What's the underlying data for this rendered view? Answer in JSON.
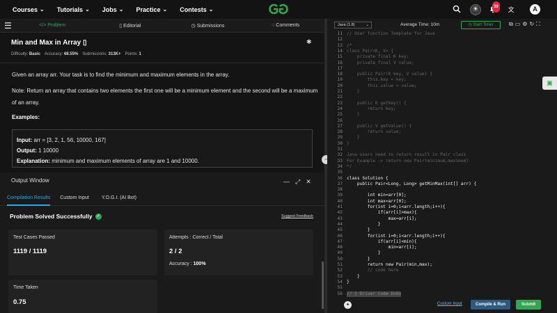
{
  "nav": {
    "items": [
      "Courses",
      "Tutorials",
      "Jobs",
      "Practice",
      "Contests"
    ],
    "notification_count": "39",
    "avatar_initial": "A"
  },
  "tabs": {
    "problem": "Problem",
    "editorial": "Editorial",
    "submissions": "Submissions",
    "comments": "Comments"
  },
  "problem": {
    "title": "Min and Max in Array",
    "difficulty_label": "Difficulty:",
    "difficulty": "Basic",
    "accuracy_label": "Accuracy:",
    "accuracy": "68.55%",
    "submissions_label": "Submissions:",
    "submissions": "313K+",
    "points_label": "Points:",
    "points": "1",
    "desc1": "Given an array arr. Your task is to find the minimum and maximum elements in the array.",
    "desc2": "Note: Return an array that contains two elements the first one will be a minimum element and the second will be a maximum of an array.",
    "examples_heading": "Examples:",
    "input_label": "Input:",
    "input_value": " arr = [3, 2, 1, 56, 10000, 167]",
    "output_label": "Output:",
    "output_value": " 1 10000",
    "explanation_label": "Explanation:",
    "explanation_value": " minimum and maximum elements of array are 1 and 10000."
  },
  "output_window": {
    "title": "Output Window",
    "tabs": [
      "Compilation Results",
      "Custom Input",
      "Y.O.G.I. (AI Bot)"
    ],
    "status": "Problem Solved Successfully",
    "suggest_feedback": "Suggest Feedback",
    "test_cases_label": "Test Cases Passed",
    "test_cases_value": "1119 / 1119",
    "attempts_label": "Attempts : Correct / Total",
    "attempts_value": "2 / 2",
    "accuracy_label": "Accuracy :",
    "accuracy_value": "100%",
    "time_label": "Time Taken",
    "time_value": "0.75"
  },
  "editor": {
    "language": "Java (1.8)",
    "average_time": "Average Time: 10m",
    "start_timer": "Start Timer",
    "lines": [
      {
        "n": "11",
        "t": "// User function Template for Java",
        "c": "cm"
      },
      {
        "n": "12",
        "t": "",
        "c": ""
      },
      {
        "n": "13",
        "t": "/*",
        "c": "cm"
      },
      {
        "n": "14",
        "t": "class Pair<K, V> {",
        "c": "cm"
      },
      {
        "n": "15",
        "t": "    private final K key;",
        "c": "cm"
      },
      {
        "n": "16",
        "t": "    private final V value;",
        "c": "cm"
      },
      {
        "n": "17",
        "t": "",
        "c": ""
      },
      {
        "n": "18",
        "t": "    public Pair(K key, V value) {",
        "c": "cm"
      },
      {
        "n": "19",
        "t": "        this.key = key;",
        "c": "cm"
      },
      {
        "n": "20",
        "t": "        this.value = value;",
        "c": "cm"
      },
      {
        "n": "21",
        "t": "    }",
        "c": "cm"
      },
      {
        "n": "22",
        "t": "",
        "c": ""
      },
      {
        "n": "23",
        "t": "    public K getKey() {",
        "c": "cm"
      },
      {
        "n": "24",
        "t": "        return key;",
        "c": "cm"
      },
      {
        "n": "25",
        "t": "    }",
        "c": "cm"
      },
      {
        "n": "26",
        "t": "",
        "c": ""
      },
      {
        "n": "27",
        "t": "    public V getValue() {",
        "c": "cm"
      },
      {
        "n": "28",
        "t": "        return value;",
        "c": "cm"
      },
      {
        "n": "29",
        "t": "    }",
        "c": "cm"
      },
      {
        "n": "30",
        "t": "}",
        "c": "cm"
      },
      {
        "n": "31",
        "t": "",
        "c": ""
      },
      {
        "n": "32",
        "t": "Java users need to return result in Pair class",
        "c": "cm"
      },
      {
        "n": "33",
        "t": "For Example -> return new Pair(minimum,maximum)",
        "c": "cm"
      },
      {
        "n": "34",
        "t": "*/",
        "c": "cm"
      },
      {
        "n": "35",
        "t": "",
        "c": ""
      },
      {
        "n": "36",
        "t": "class Solution {",
        "c": "kw"
      },
      {
        "n": "37",
        "t": "    public Pair<Long, Long> getMinMax(int[] arr) {",
        "c": "kw"
      },
      {
        "n": "38",
        "t": "",
        "c": ""
      },
      {
        "n": "39",
        "t": "        int min=arr[0];",
        "c": "kw"
      },
      {
        "n": "40",
        "t": "        int max=arr[0];",
        "c": "kw"
      },
      {
        "n": "41",
        "t": "        for(int i=0;i<arr.length;i++){",
        "c": "kw"
      },
      {
        "n": "42",
        "t": "            if(arr[i]>max){",
        "c": "kw"
      },
      {
        "n": "43",
        "t": "                max=arr[i];",
        "c": "kw"
      },
      {
        "n": "44",
        "t": "            }",
        "c": "kw"
      },
      {
        "n": "45",
        "t": "        }",
        "c": "kw"
      },
      {
        "n": "46",
        "t": "        for(int i=0;i<arr.length;i++){",
        "c": "kw"
      },
      {
        "n": "47",
        "t": "            if(arr[i]<min){",
        "c": "kw"
      },
      {
        "n": "48",
        "t": "                min=arr[i];",
        "c": "kw"
      },
      {
        "n": "49",
        "t": "            }",
        "c": "kw"
      },
      {
        "n": "50",
        "t": "        }",
        "c": "kw"
      },
      {
        "n": "51",
        "t": "        return new Pair(min,max);",
        "c": "kw"
      },
      {
        "n": "52",
        "t": "        // code here",
        "c": "cm"
      },
      {
        "n": "53",
        "t": "    }",
        "c": "kw"
      },
      {
        "n": "54",
        "t": "}",
        "c": "kw"
      },
      {
        "n": "55",
        "t": "",
        "c": ""
      },
      {
        "n": "56",
        "t": "// } Driver Code Ends",
        "c": "hl"
      }
    ],
    "custom_input": "Custom Input",
    "compile_run": "Compile & Run",
    "submit": "Submit"
  }
}
